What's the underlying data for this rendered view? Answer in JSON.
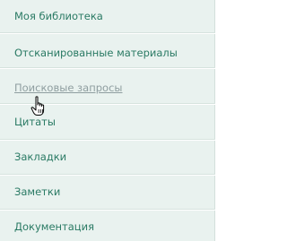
{
  "menu": {
    "items": [
      {
        "label": "Моя библиотека"
      },
      {
        "label": "Отсканированные материалы"
      },
      {
        "label": "Поисковые запросы",
        "state": "hover"
      },
      {
        "label": "Цитаты"
      },
      {
        "label": "Закладки"
      },
      {
        "label": "Заметки"
      },
      {
        "label": "Документация"
      }
    ]
  },
  "colors": {
    "menu_background": "#e9f2ef",
    "link_text": "#2a7a64",
    "hover_text": "#8f9ea0",
    "divider": "#ffffff"
  },
  "cursor": {
    "icon": "hand-pointer-icon"
  }
}
